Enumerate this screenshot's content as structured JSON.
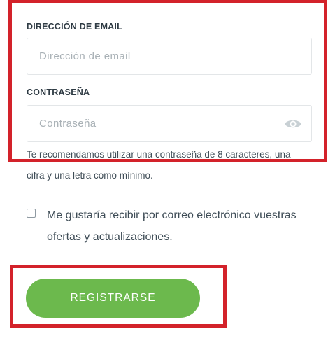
{
  "form": {
    "email": {
      "label": "DIRECCIÓN DE EMAIL",
      "placeholder": "Dirección de email",
      "value": ""
    },
    "password": {
      "label": "CONTRASEÑA",
      "placeholder": "Contraseña",
      "value": "",
      "toggle_icon": "eye-icon"
    },
    "password_hint": "Te recomendamos utilizar una contraseña de 8 caracteres, una cifra y una letra como mínimo.",
    "newsletter": {
      "label": "Me gustaría recibir por correo electrónico vuestras ofertas y actualizaciones.",
      "checked": false
    },
    "submit_label": "REGISTRARSE"
  },
  "colors": {
    "annotation": "#d3222a",
    "button": "#6cb94d",
    "text": "#3e4c56",
    "placeholder": "#a9b1b6"
  }
}
